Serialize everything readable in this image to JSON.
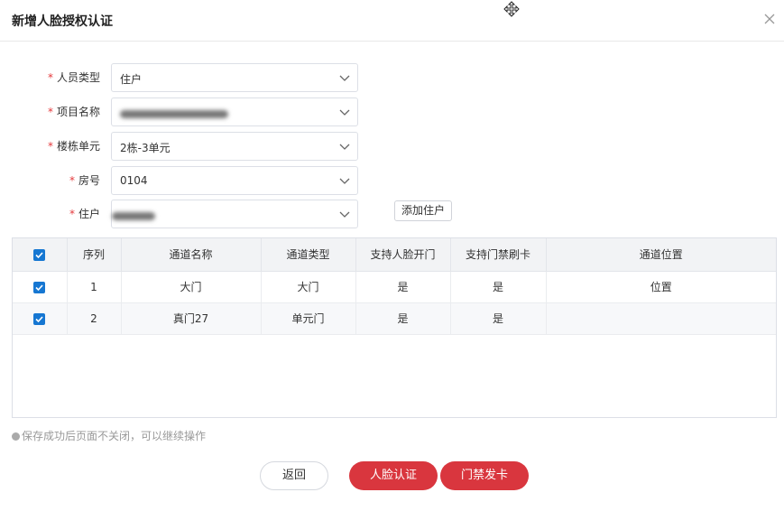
{
  "dialog": {
    "title": "新增人脸授权认证",
    "close_icon": "close-icon",
    "move_icon": "move-cursor-icon"
  },
  "form": {
    "required_mark": "*",
    "fields": [
      {
        "label": "人员类型",
        "value": "住户",
        "required": true,
        "obscured": false
      },
      {
        "label": "项目名称",
        "value": "",
        "required": true,
        "obscured": true
      },
      {
        "label": "楼栋单元",
        "value": "2栋-3单元",
        "required": true,
        "obscured": false
      },
      {
        "label": "房号",
        "value": "0104",
        "required": true,
        "obscured": false
      },
      {
        "label": "住户",
        "value": "",
        "required": true,
        "obscured": true
      }
    ],
    "add_resident_label": "添加住户"
  },
  "table": {
    "columns": [
      "序列",
      "通道名称",
      "通道类型",
      "支持人脸开门",
      "支持门禁刷卡",
      "通道位置"
    ],
    "select_all_checked": true,
    "rows": [
      {
        "checked": true,
        "index": "1",
        "name": "大门",
        "type": "大门",
        "face": "是",
        "card": "是",
        "location": "位置"
      },
      {
        "checked": true,
        "index": "2",
        "name": "真门27",
        "type": "单元门",
        "face": "是",
        "card": "是",
        "location": ""
      }
    ]
  },
  "note": "保存成功后页面不关闭，可以继续操作",
  "buttons": {
    "back": "返回",
    "face_auth": "人脸认证",
    "card_issue": "门禁发卡"
  },
  "colors": {
    "primary_red": "#d9363e",
    "checkbox_blue": "#1677d2",
    "required_red": "#e4393c"
  }
}
